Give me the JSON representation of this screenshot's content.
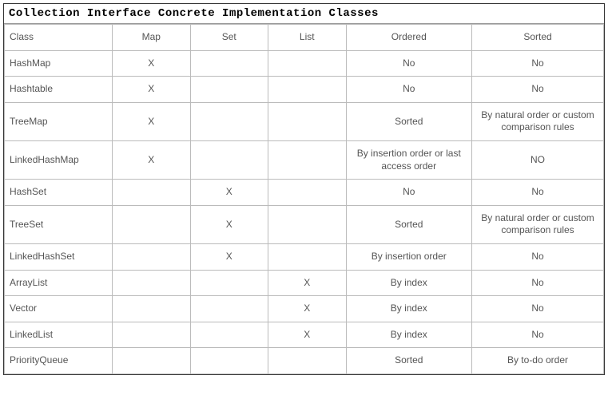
{
  "title": "Collection Interface Concrete Implementation Classes",
  "chart_data": {
    "type": "table",
    "columns": [
      "Class",
      "Map",
      "Set",
      "List",
      "Ordered",
      "Sorted"
    ],
    "rows": [
      {
        "Class": "HashMap",
        "Map": "X",
        "Set": "",
        "List": "",
        "Ordered": "No",
        "Sorted": "No"
      },
      {
        "Class": "Hashtable",
        "Map": "X",
        "Set": "",
        "List": "",
        "Ordered": "No",
        "Sorted": "No"
      },
      {
        "Class": "TreeMap",
        "Map": "X",
        "Set": "",
        "List": "",
        "Ordered": "Sorted",
        "Sorted": "By natural order or custom comparison rules"
      },
      {
        "Class": "LinkedHashMap",
        "Map": "X",
        "Set": "",
        "List": "",
        "Ordered": "By insertion order or last access order",
        "Sorted": "NO"
      },
      {
        "Class": "HashSet",
        "Map": "",
        "Set": "X",
        "List": "",
        "Ordered": "No",
        "Sorted": "No"
      },
      {
        "Class": "TreeSet",
        "Map": "",
        "Set": "X",
        "List": "",
        "Ordered": "Sorted",
        "Sorted": "By natural order or custom comparison rules"
      },
      {
        "Class": "LinkedHashSet",
        "Map": "",
        "Set": "X",
        "List": "",
        "Ordered": "By insertion order",
        "Sorted": "No"
      },
      {
        "Class": "ArrayList",
        "Map": "",
        "Set": "",
        "List": "X",
        "Ordered": "By index",
        "Sorted": "No"
      },
      {
        "Class": "Vector",
        "Map": "",
        "Set": "",
        "List": "X",
        "Ordered": "By index",
        "Sorted": "No"
      },
      {
        "Class": "LinkedList",
        "Map": "",
        "Set": "",
        "List": "X",
        "Ordered": "By index",
        "Sorted": "No"
      },
      {
        "Class": "PriorityQueue",
        "Map": "",
        "Set": "",
        "List": "",
        "Ordered": "Sorted",
        "Sorted": "By to-do order"
      }
    ]
  }
}
